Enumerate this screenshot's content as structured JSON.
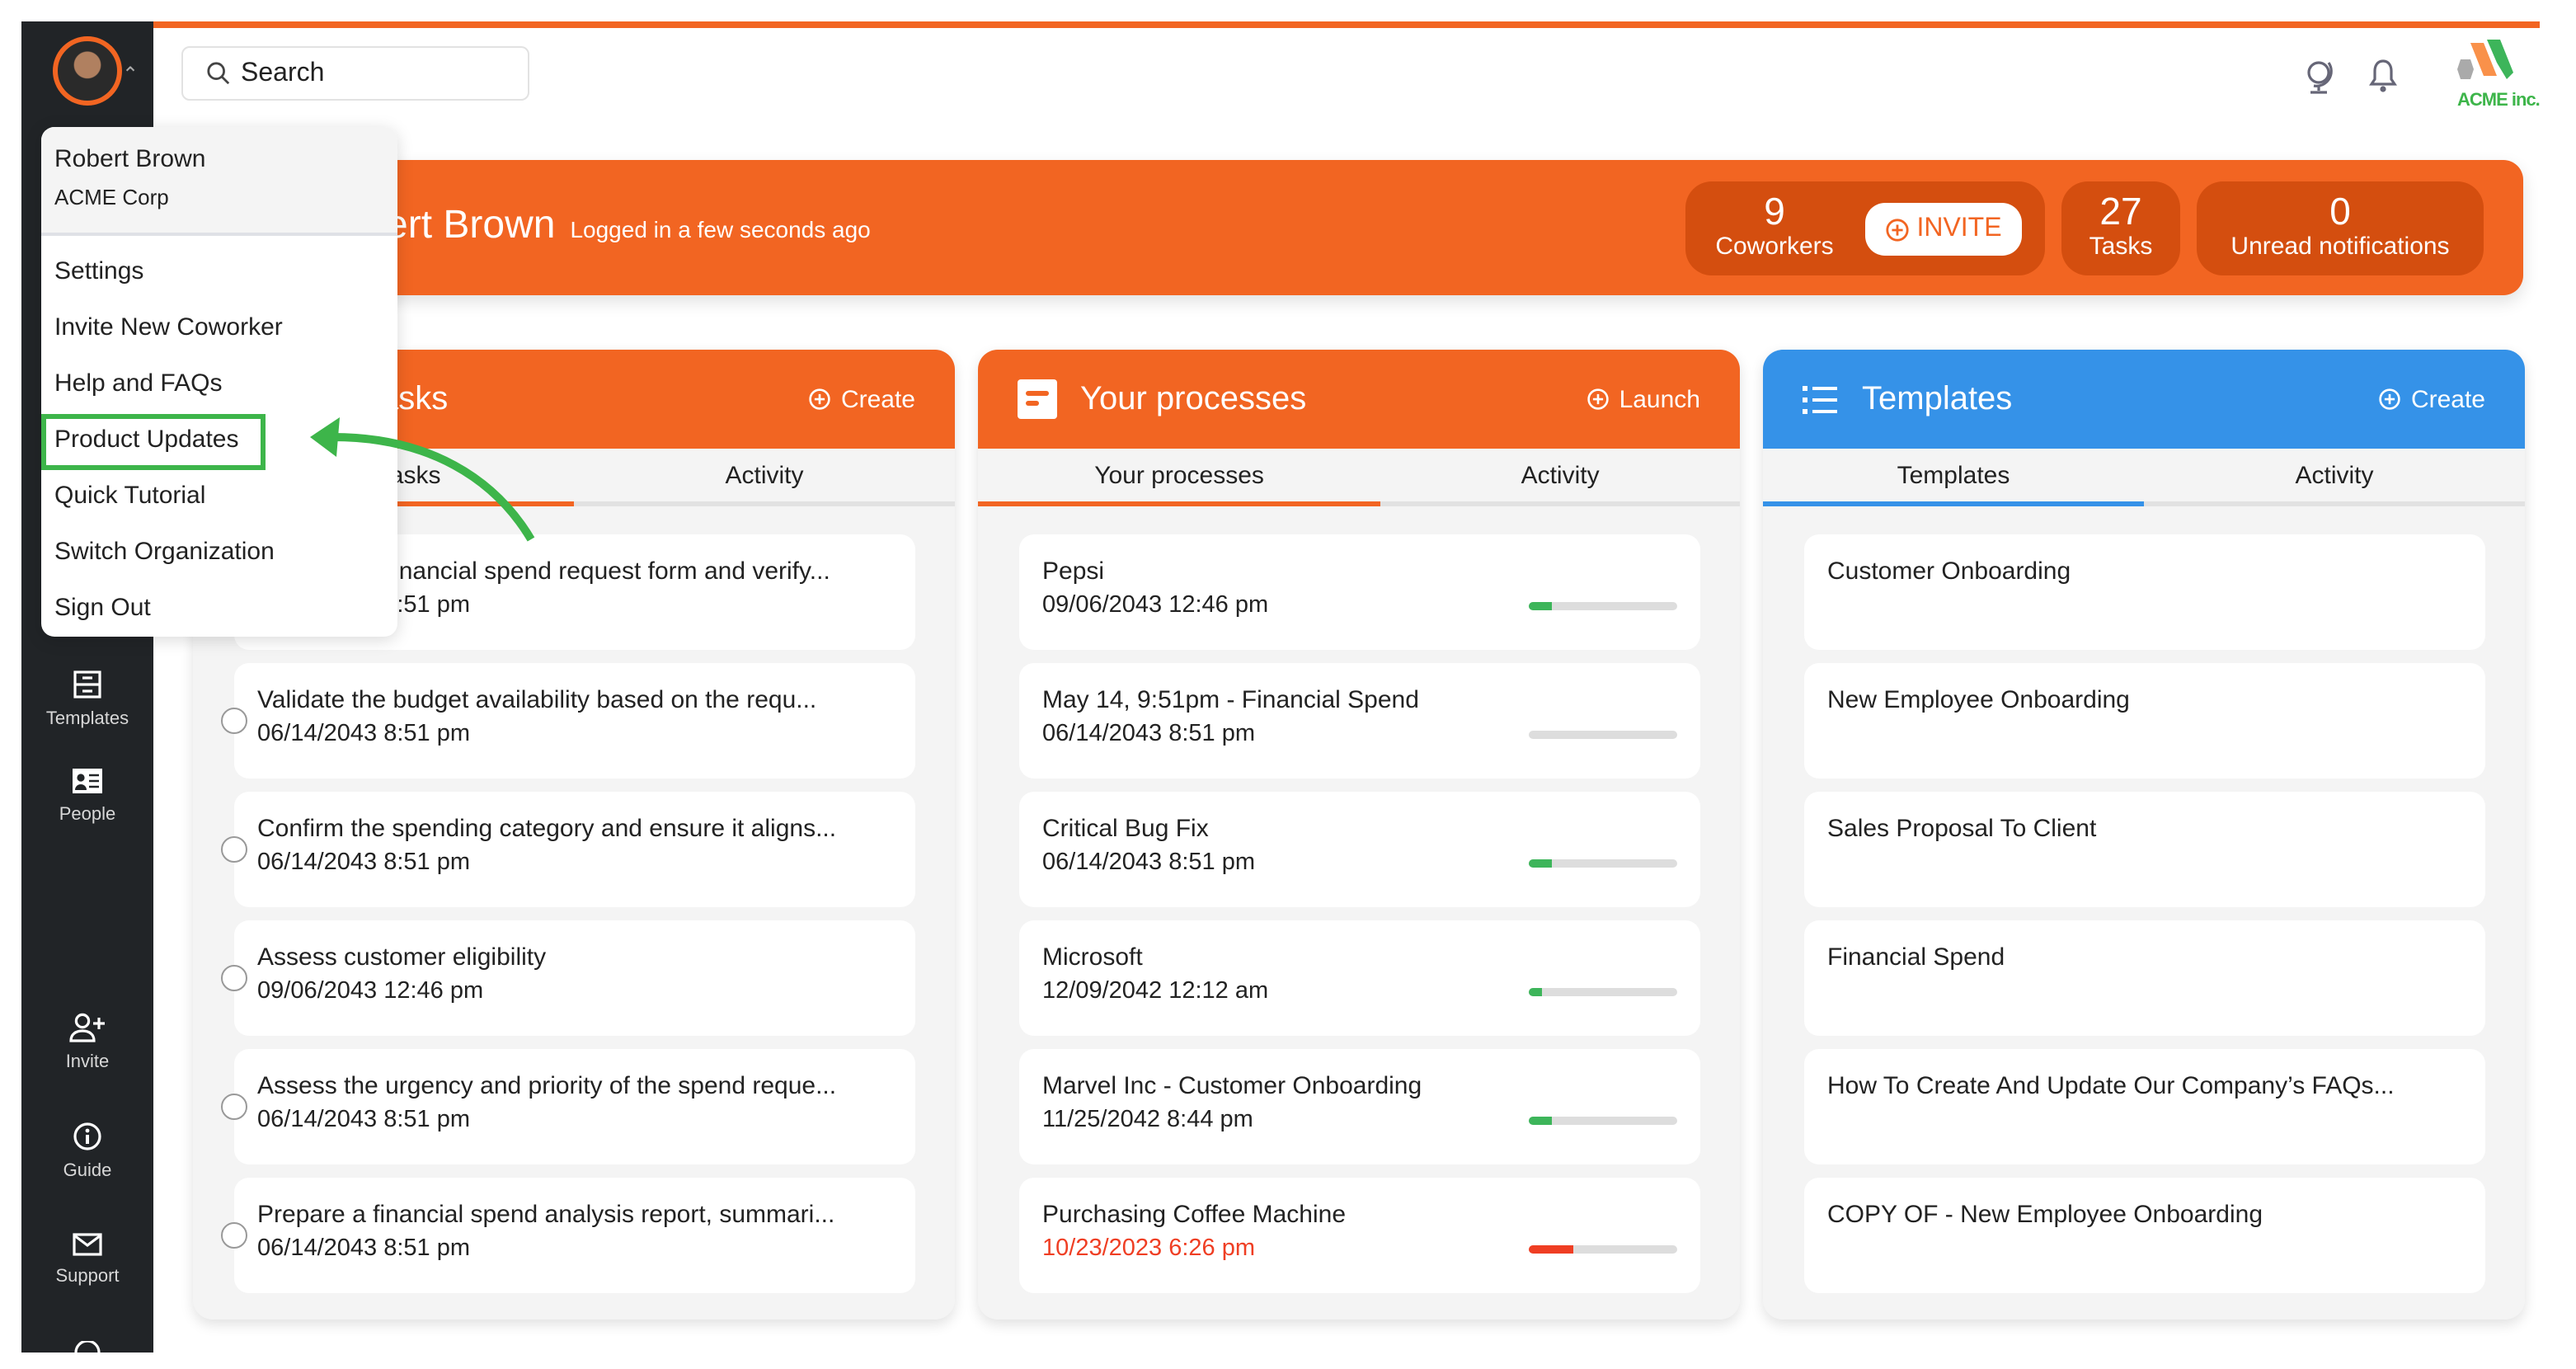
{
  "search": {
    "placeholder": "Search"
  },
  "sidebar": {
    "items": [
      {
        "label": "Templates",
        "icon": "templates-icon"
      },
      {
        "label": "People",
        "icon": "people-icon"
      },
      {
        "label": "Invite",
        "icon": "user-plus-icon"
      },
      {
        "label": "Guide",
        "icon": "info-icon"
      },
      {
        "label": "Support",
        "icon": "envelope-icon"
      }
    ]
  },
  "header": {
    "logo_text": "ACME inc."
  },
  "banner": {
    "name": "Robert Brown",
    "status": "Logged in a few seconds ago",
    "stats": [
      {
        "value": "9",
        "label": "Coworkers"
      },
      {
        "value": "27",
        "label": "Tasks"
      },
      {
        "value": "0",
        "label": "Unread notifications"
      }
    ],
    "invite_label": "INVITE"
  },
  "user_menu": {
    "name": "Robert Brown",
    "org": "ACME Corp",
    "items": [
      "Settings",
      "Invite New Coworker",
      "Help and FAQs",
      "Product Updates",
      "Quick Tutorial",
      "Switch Organization",
      "Sign Out"
    ],
    "highlighted": "Product Updates"
  },
  "panels": {
    "tasks": {
      "title": "Your tasks",
      "action": "Create",
      "tabs": [
        "Your tasks",
        "Activity"
      ],
      "color": "#F26522",
      "items": [
        {
          "title": "Review the financial spend request form and verify...",
          "date": "06/14/2043 8:51 pm"
        },
        {
          "title": "Validate the budget availability based on the requ...",
          "date": "06/14/2043 8:51 pm"
        },
        {
          "title": "Confirm the spending category and ensure it aligns...",
          "date": "06/14/2043 8:51 pm"
        },
        {
          "title": "Assess customer eligibility",
          "date": "09/06/2043 12:46 pm"
        },
        {
          "title": "Assess the urgency and priority of the spend reque...",
          "date": "06/14/2043 8:51 pm"
        },
        {
          "title": "Prepare a financial spend analysis report, summari...",
          "date": "06/14/2043 8:51 pm"
        }
      ]
    },
    "processes": {
      "title": "Your processes",
      "action": "Launch",
      "tabs": [
        "Your processes",
        "Activity"
      ],
      "color": "#F26522",
      "items": [
        {
          "title": "Pepsi",
          "date": "09/06/2043 12:46 pm",
          "progress": 0.16,
          "status": "ok"
        },
        {
          "title": "May 14, 9:51pm - Financial Spend",
          "date": "06/14/2043 8:51 pm",
          "progress": 0,
          "status": "ok"
        },
        {
          "title": "Critical Bug Fix",
          "date": "06/14/2043 8:51 pm",
          "progress": 0.16,
          "status": "ok"
        },
        {
          "title": "Microsoft",
          "date": "12/09/2042 12:12 am",
          "progress": 0.09,
          "status": "ok"
        },
        {
          "title": "Marvel Inc - Customer Onboarding",
          "date": "11/25/2042 8:44 pm",
          "progress": 0.16,
          "status": "ok"
        },
        {
          "title": "Purchasing Coffee Machine",
          "date": "10/23/2023 6:26 pm",
          "progress": 0.3,
          "status": "overdue"
        }
      ]
    },
    "templates": {
      "title": "Templates",
      "action": "Create",
      "tabs": [
        "Templates",
        "Activity"
      ],
      "color": "#3592E8",
      "items": [
        {
          "title": "Customer Onboarding"
        },
        {
          "title": "New Employee Onboarding"
        },
        {
          "title": "Sales Proposal To Client"
        },
        {
          "title": "Financial Spend"
        },
        {
          "title": "How To Create And Update Our Company’s FAQs..."
        },
        {
          "title": "COPY OF - New Employee Onboarding"
        }
      ]
    }
  },
  "colors": {
    "accent": "#F26522",
    "accent_dark": "#D44E0F",
    "templates": "#3592E8",
    "progress_ok": "#3DB55A",
    "progress_overdue": "#EF3E23",
    "highlight": "#3DB54A",
    "sidebar": "#212427"
  }
}
